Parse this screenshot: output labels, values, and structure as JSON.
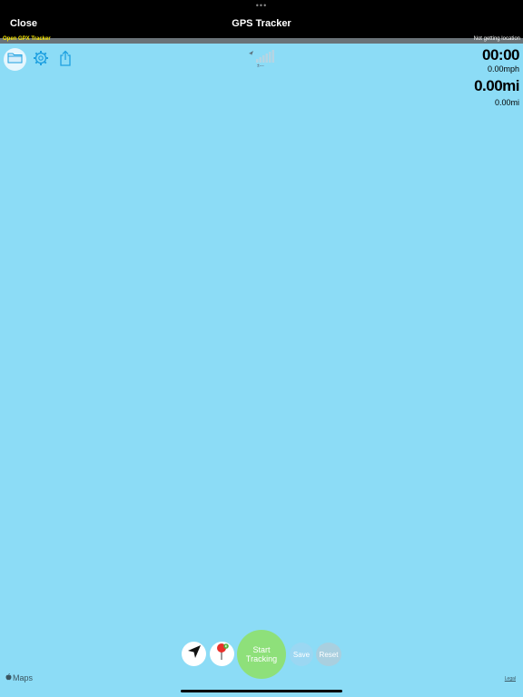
{
  "window": {
    "dots": "•••",
    "close_label": "Close",
    "title": "GPS Tracker"
  },
  "status_strip": {
    "app_name": "Open GPX Tracker",
    "location_status": "Not getting location",
    "app_name_color": "#f6e400"
  },
  "toolbar": {
    "folder_icon": "folder-icon",
    "settings_icon": "gear-icon",
    "share_icon": "share-icon"
  },
  "signal": {
    "icon": "signal-bars-icon",
    "accuracy_text": "±---"
  },
  "stats": {
    "timer": "00:00",
    "speed": "0.00mph",
    "total_distance": "0.00mi",
    "segment_distance": "0.00mi"
  },
  "controls": {
    "follow_icon": "navigation-arrow-icon",
    "pin_icon": "map-pin-icon",
    "start_label_line1": "Start",
    "start_label_line2": "Tracking",
    "save_label": "Save",
    "reset_label": "Reset"
  },
  "map": {
    "attribution": "Maps",
    "legal": "Legal",
    "background_color": "#8cdcf6"
  },
  "colors": {
    "accent": "#1ea0e0",
    "start_button": "#8ee07a",
    "pin": "#e8302a"
  }
}
